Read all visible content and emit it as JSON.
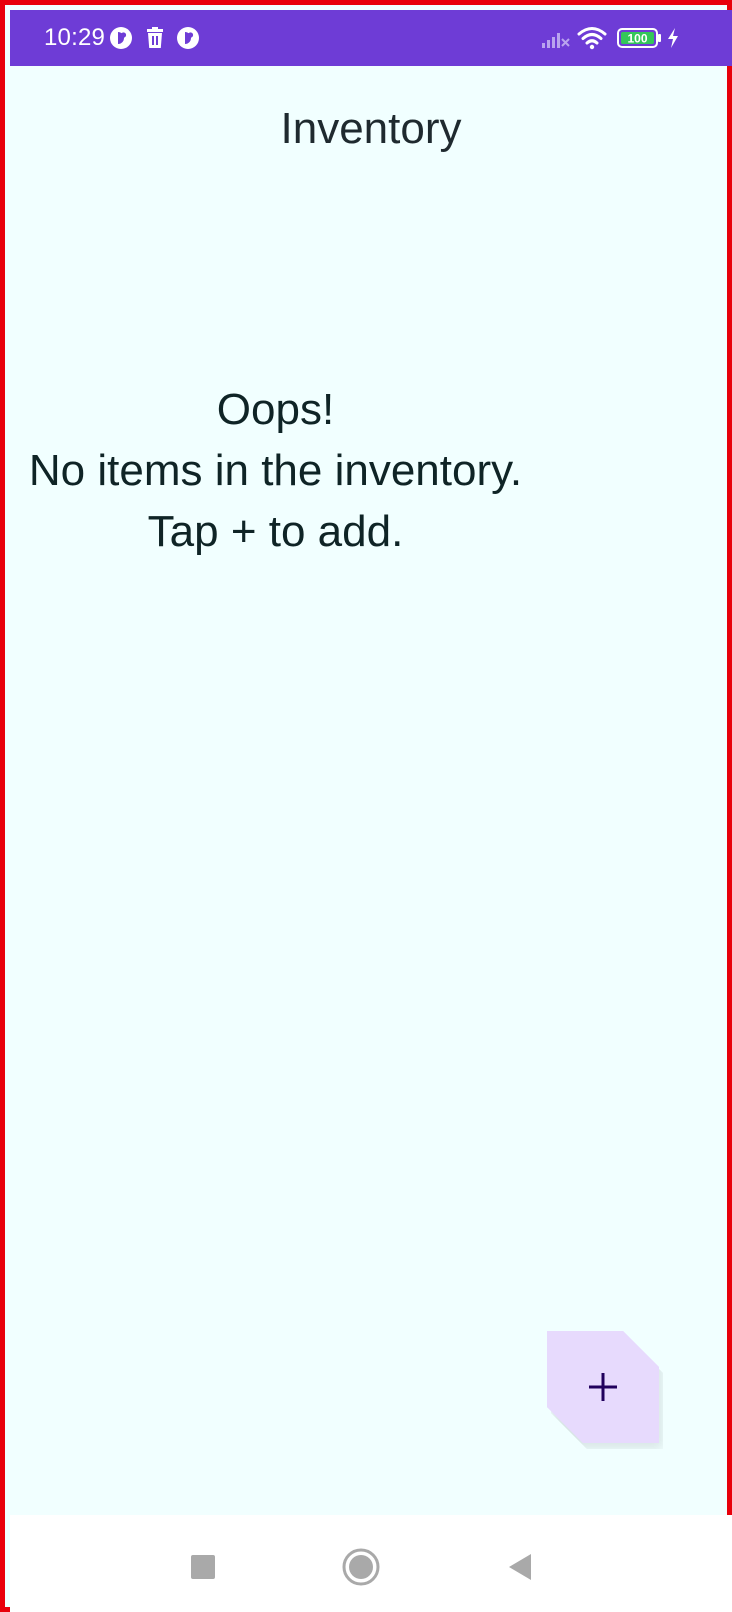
{
  "status_bar": {
    "time": "10:29",
    "battery_level": "100",
    "left_icons": [
      "app-notification-icon",
      "trash-icon",
      "app-notification-icon"
    ],
    "right_icons": [
      "cell-signal-icon",
      "wifi-icon",
      "battery-icon",
      "charging-bolt-icon"
    ],
    "background_color": "#6e3cd6"
  },
  "app_bar": {
    "title": "Inventory"
  },
  "empty_state": {
    "line1": "Oops!",
    "line2": "No items in the inventory.",
    "line3": "Tap + to add."
  },
  "fab": {
    "icon": "plus-icon",
    "background_color": "#e7dafd"
  },
  "nav_bar": {
    "buttons": [
      "recents-square-icon",
      "home-circle-icon",
      "back-triangle-icon"
    ]
  },
  "colors": {
    "frame_border": "#e8000b",
    "background": "#f1ffff",
    "text": "#0f2426"
  }
}
